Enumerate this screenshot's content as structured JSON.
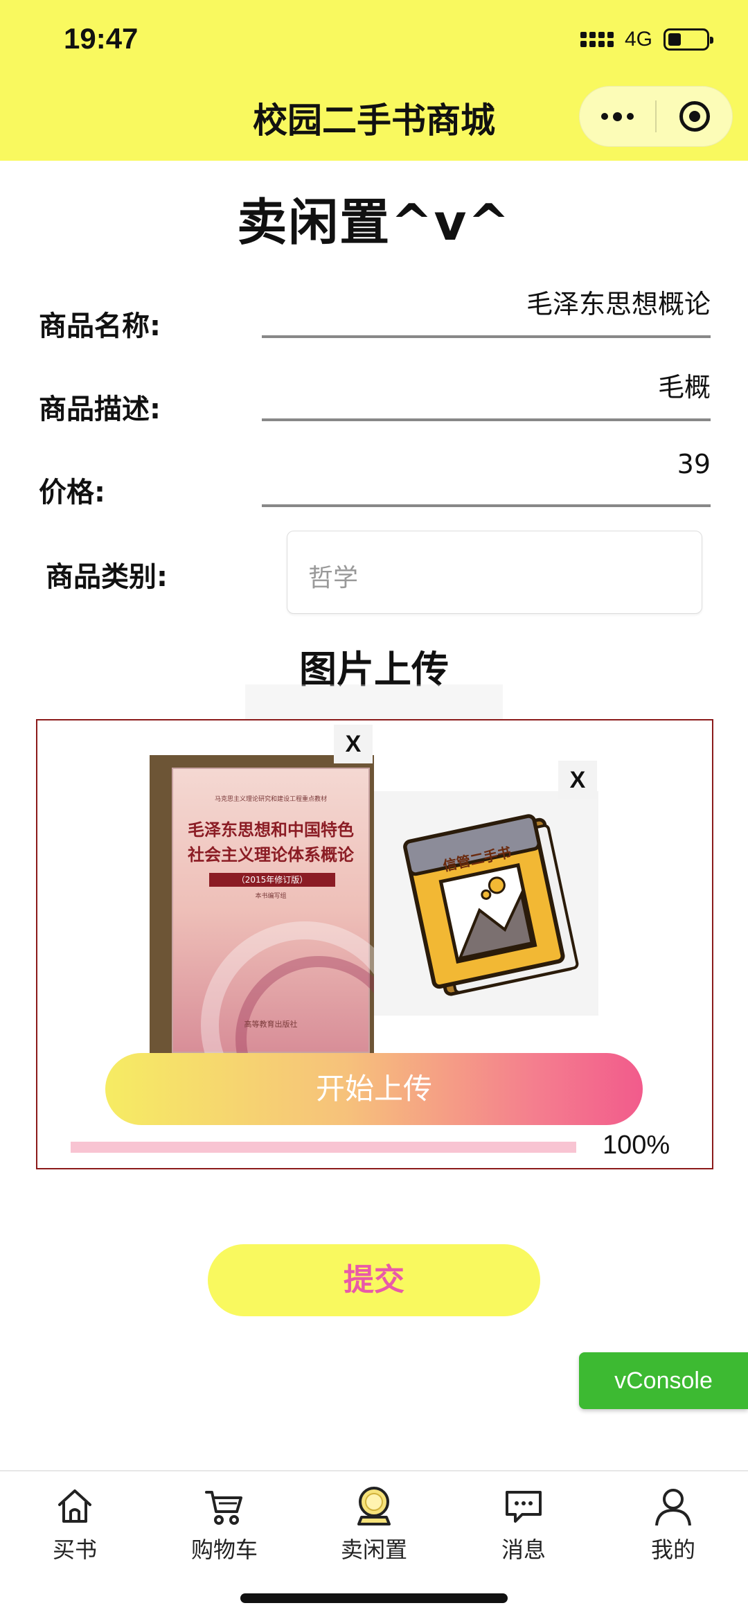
{
  "status_bar": {
    "time": "19:47",
    "network": "4G"
  },
  "header": {
    "title": "校园二手书商城"
  },
  "page_title": "卖闲置^v^",
  "form": {
    "name_label": "商品名称:",
    "name_value": "毛泽东思想概论",
    "desc_label": "商品描述:",
    "desc_value": "毛概",
    "price_label": "价格:",
    "price_value": "39",
    "category_label": "商品类别:",
    "category_value": "哲学"
  },
  "upload": {
    "section_title": "图片上传",
    "close_label": "X",
    "cover_text": {
      "series": "马克思主义理论研究和建设工程重点教材",
      "line1": "毛泽东思想和中国特色",
      "line2": "社会主义理论体系概论",
      "edition": "（2015年修订版）",
      "editor": "本书编写组",
      "publisher": "高等教育出版社"
    },
    "sticker_text": "信管二手书",
    "start_button": "开始上传",
    "progress_percent": 100,
    "progress_label": "100%"
  },
  "submit_button": "提交",
  "vconsole_label": "vConsole",
  "tabbar": {
    "items": [
      {
        "label": "买书",
        "icon": "home-icon"
      },
      {
        "label": "购物车",
        "icon": "cart-icon"
      },
      {
        "label": "卖闲置",
        "icon": "sell-icon"
      },
      {
        "label": "消息",
        "icon": "message-icon"
      },
      {
        "label": "我的",
        "icon": "user-icon"
      }
    ]
  }
}
